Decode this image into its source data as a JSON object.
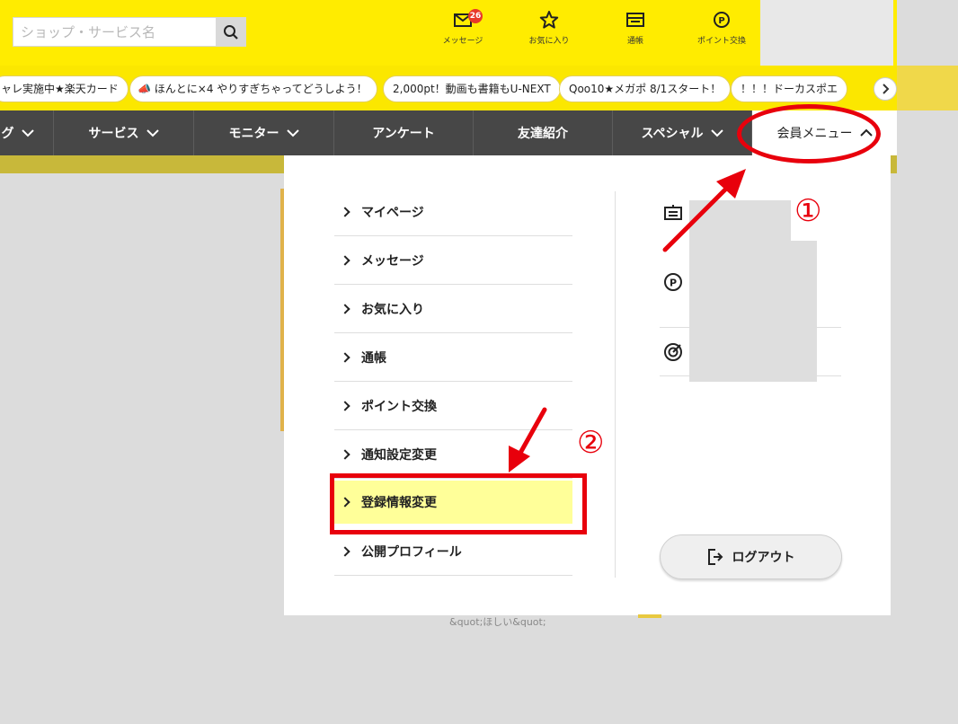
{
  "header": {
    "search_placeholder": "ショップ・サービス名",
    "icons": [
      {
        "name": "message",
        "label": "メッセージ",
        "badge": "26"
      },
      {
        "name": "favorite",
        "label": "お気に入り"
      },
      {
        "name": "passbook",
        "label": "通帳"
      },
      {
        "name": "point-exchange",
        "label": "ポイント交換"
      }
    ]
  },
  "ticker": {
    "items": [
      "ャレ実施中★楽天カード",
      "ほんとに×4 やりすぎちゃってどうしよう！",
      "2,000pt！動画も書籍もU-NEXT",
      "Qoo10★メガポ 8/1スタート！",
      "！！！ドーカスポエ"
    ]
  },
  "nav": {
    "items": [
      "グ",
      "サービス",
      "モニター",
      "アンケート",
      "友達紹介",
      "スペシャル",
      "会員メニュー"
    ]
  },
  "dropdown": {
    "menu": [
      "マイページ",
      "メッセージ",
      "お気に入り",
      "通帳",
      "ポイント交換",
      "通知設定変更",
      "登録情報変更",
      "公開プロフィール"
    ],
    "logout_label": "ログアウト"
  },
  "remnants": {
    "text": "&quot;ほしい&quot;"
  },
  "annotations": {
    "step1": "①",
    "step2": "②",
    "color": "#e8000c"
  },
  "colors": {
    "brand_yellow": "#ffec00",
    "nav_dark": "#474747",
    "highlight": "#ffff99"
  }
}
